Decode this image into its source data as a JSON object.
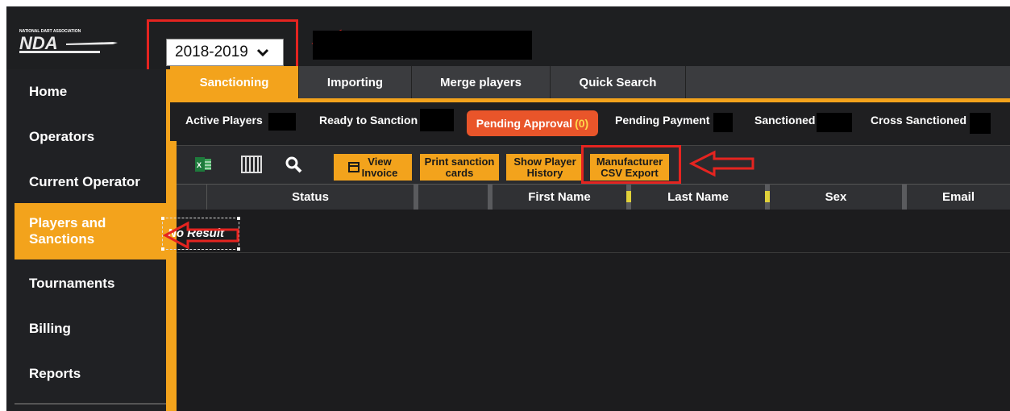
{
  "header": {
    "logo_text": "NDA",
    "season_select_value": "2018-2019"
  },
  "sidebar": {
    "items": [
      {
        "label": "Home"
      },
      {
        "label": "Operators"
      },
      {
        "label": "Current Operator"
      },
      {
        "label": "Players and\nSanctions",
        "active": true
      },
      {
        "label": "Tournaments"
      },
      {
        "label": "Billing"
      },
      {
        "label": "Reports"
      }
    ]
  },
  "tabs": [
    {
      "label": "Sanctioning",
      "active": true
    },
    {
      "label": "Importing"
    },
    {
      "label": "Merge players"
    },
    {
      "label": "Quick Search"
    }
  ],
  "filters": {
    "active_players": "Active Players",
    "ready_to_sanction": "Ready to Sanction",
    "pending_approval": "Pending Approval",
    "pending_approval_count": "(0)",
    "pending_payment": "Pending Payment",
    "sanctioned": "Sanctioned",
    "cross_sanctioned": "Cross Sanctioned"
  },
  "toolbar": {
    "excel_icon": "excel-icon",
    "columns_icon": "columns-icon",
    "search_icon": "search-icon",
    "view_invoice_line1": "View",
    "view_invoice_line2": "Invoice",
    "print_cards_line1": "Print sanction",
    "print_cards_line2": "cards",
    "show_history_line1": "Show Player",
    "show_history_line2": "History",
    "csv_export_line1": "Manufacturer",
    "csv_export_line2": "CSV Export"
  },
  "grid": {
    "columns": [
      "Status",
      "",
      "First Name",
      "Last Name",
      "Sex",
      "Email"
    ],
    "empty_text": "No Result"
  },
  "colors": {
    "accent": "#f3a31c",
    "pending": "#e9552a",
    "annotation": "#e52420",
    "background": "#1e1f21"
  }
}
